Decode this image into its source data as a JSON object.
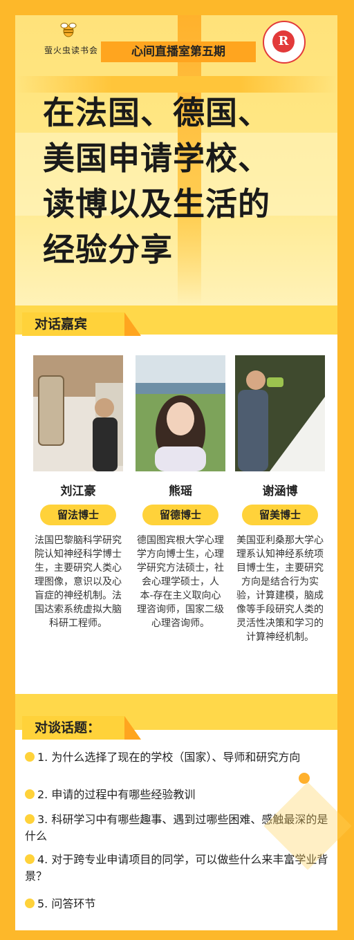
{
  "header": {
    "logo_left_text": "萤火虫读书会",
    "logo_right_letter": "R",
    "session_label": "心间直播室第五期",
    "title_lines": [
      "在法国、德国、",
      "美国申请学校、",
      "读博以及生活的",
      "经验分享"
    ]
  },
  "guests_section": {
    "tag": "对话嘉宾",
    "guests": [
      {
        "name": "刘江豪",
        "badge": "留法博士",
        "desc": "法国巴黎脑科学研究院认知神经科学博士生，主要研究人类心理图像，意识以及心盲症的神经机制。法国达索系统虚拟大脑科研工程师。"
      },
      {
        "name": "熊瑶",
        "badge": "留德博士",
        "desc": "德国图宾根大学心理学方向博士生，心理学研究方法硕士，社会心理学硕士，人本-存在主义取向心理咨询师，国家二级心理咨询师。"
      },
      {
        "name": "谢涵博",
        "badge": "留美博士",
        "desc": "美国亚利桑那大学心理系认知神经系统项目博士生，主要研究方向是结合行为实验，计算建模，脑成像等手段研究人类的灵活性决策和学习的计算神经机制。"
      }
    ]
  },
  "topics_section": {
    "tag": "对谈话题：",
    "items": [
      "1. 为什么选择了现在的学校（国家）、导师和研究方向",
      "2. 申请的过程中有哪些经验教训",
      "3. 科研学习中有哪些趣事、遇到过哪些困难、感触最深的是什么",
      "4. 对于跨专业申请项目的同学，可以做些什么来丰富学业背景？",
      "5. 问答环节"
    ]
  },
  "colors": {
    "frame": "#FDB82A",
    "accent": "#FFD23A",
    "accent_dark": "#FFA51F",
    "logo_red": "#E23A3A"
  }
}
